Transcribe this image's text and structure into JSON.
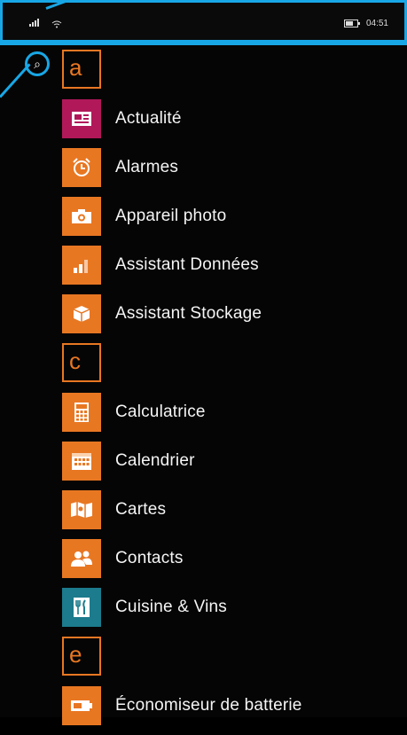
{
  "status": {
    "time": "04:51"
  },
  "apps": {
    "sections": [
      {
        "letter": "a",
        "items": [
          {
            "label": "Actualité",
            "icon": "newspaper-icon",
            "color": "#b1185a"
          },
          {
            "label": "Alarmes",
            "icon": "alarm-clock-icon",
            "color": "#e87722"
          },
          {
            "label": "Appareil photo",
            "icon": "camera-icon",
            "color": "#e87722"
          },
          {
            "label": "Assistant Données",
            "icon": "data-bars-icon",
            "color": "#e87722"
          },
          {
            "label": "Assistant Stockage",
            "icon": "storage-box-icon",
            "color": "#e87722"
          }
        ]
      },
      {
        "letter": "c",
        "items": [
          {
            "label": "Calculatrice",
            "icon": "calculator-icon",
            "color": "#e87722"
          },
          {
            "label": "Calendrier",
            "icon": "calendar-icon",
            "color": "#e87722"
          },
          {
            "label": "Cartes",
            "icon": "map-icon",
            "color": "#e87722"
          },
          {
            "label": "Contacts",
            "icon": "people-icon",
            "color": "#e87722"
          },
          {
            "label": "Cuisine & Vins",
            "icon": "fork-knife-icon",
            "color": "#1c7b8c"
          }
        ]
      },
      {
        "letter": "e",
        "items": [
          {
            "label": "Économiseur de batterie",
            "icon": "battery-icon",
            "color": "#e87722"
          }
        ]
      }
    ]
  },
  "colors": {
    "accent": "#e87722",
    "overlay": "#18a7e6",
    "background": "#000000"
  }
}
